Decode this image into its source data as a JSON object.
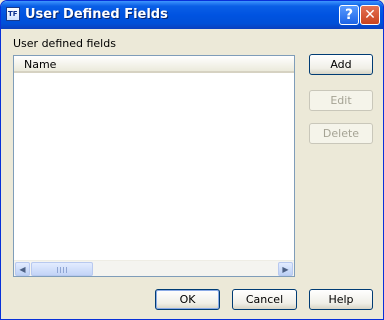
{
  "window": {
    "title": "User Defined Fields",
    "icon_glyph": "TF",
    "help_glyph": "?",
    "close_glyph": "✕"
  },
  "group": {
    "label": "User defined fields"
  },
  "list": {
    "columns": [
      "Name"
    ],
    "rows": [],
    "scroll": {
      "left_glyph": "◀",
      "right_glyph": "▶"
    }
  },
  "buttons": {
    "add": "Add",
    "edit": "Edit",
    "delete": "Delete",
    "ok": "OK",
    "cancel": "Cancel",
    "help": "Help"
  }
}
